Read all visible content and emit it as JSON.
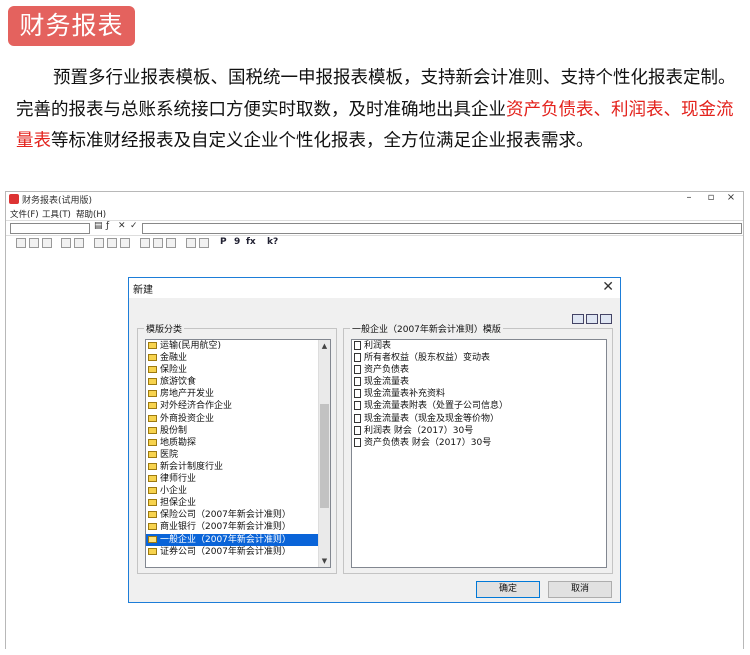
{
  "banner": {
    "title": "财务报表"
  },
  "intro": {
    "p1": "预置多行业报表模板、国税统一申报报表模板，支持新会计准则、支持个性化报表定制。完善的报表与总账系统接口方便实时取数，及时准确地出具企业",
    "hl1": "资产负债表、利润表、现金流量表",
    "p2": "等标准财经报表及自定义企业个性化报表，全方位满足企业报表需求。"
  },
  "app": {
    "title": "财务报表(试用版)",
    "menus": [
      "文件(F)",
      "工具(T)",
      "帮助(H)"
    ],
    "toolbar_text": [
      "P",
      "9",
      "fx",
      "k?"
    ]
  },
  "dialog": {
    "title": "新建",
    "category_legend": "模版分类",
    "template_legend": "一般企业（2007年新会计准则）模版",
    "categories": [
      "运输(民用航空)",
      "金融业",
      "保险业",
      "旅游饮食",
      "房地产开发业",
      "对外经济合作企业",
      "外商投资企业",
      "股份制",
      "地质勘探",
      "医院",
      "新会计制度行业",
      "律师行业",
      "小企业",
      "担保企业",
      "保险公司（2007年新会计准则）",
      "商业银行（2007年新会计准则）",
      "一般企业（2007年新会计准则）",
      "证券公司（2007年新会计准则）"
    ],
    "selected_category": "一般企业（2007年新会计准则）",
    "templates": [
      "利润表",
      "所有者权益（股东权益）变动表",
      "资产负债表",
      "现金流量表",
      "现金流量表补充资料",
      "现金流量表附表（处置子公司信息）",
      "现金流量表（现金及现金等价物）",
      "利润表 财会（2017）30号",
      "资产负债表 财会（2017）30号"
    ],
    "ok_label": "确定",
    "cancel_label": "取消"
  },
  "colors": {
    "banner": "#e4625e",
    "highlight": "#e3221c",
    "selection": "#0a64d8",
    "dialog_border": "#1d7dd8"
  }
}
